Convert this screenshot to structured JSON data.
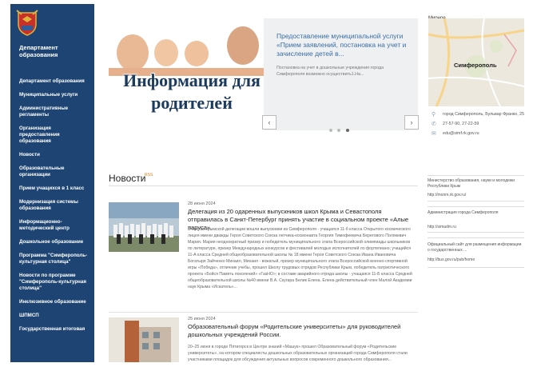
{
  "sidebar": {
    "title": "Департамент образования",
    "items": [
      {
        "label": "Департамент образования"
      },
      {
        "label": "Муниципальные услуги"
      },
      {
        "label": "Административные регламенты"
      },
      {
        "label": "Организация предоставления образования"
      },
      {
        "label": "Новости"
      },
      {
        "label": "Образовательные организации"
      },
      {
        "label": "Прием учащихся в 1 класс"
      },
      {
        "label": "Модернизация системы образования"
      },
      {
        "label": "Информационно-методический центр"
      },
      {
        "label": "Дошкольное образование"
      },
      {
        "label": "Программа \"Симферополь-культурная столица\""
      },
      {
        "label": "Новости по программе \"Симферополь-культурная столица\""
      },
      {
        "label": "Инклюзивное образование"
      },
      {
        "label": "ШПМСП"
      },
      {
        "label": "Государственная итоговая"
      }
    ]
  },
  "slider": {
    "banner_text": "Информация для родителей",
    "slide_title": "Предоставление муниципальной услуги «Прием заявлений, постановка на учет и зачисление детей в...",
    "slide_text": "Постановка на учет в дошкольные учреждения города Симферополя возможно осуществить1.На...",
    "prev": "‹",
    "next": "›"
  },
  "map": {
    "label": "Мирное",
    "city": "Симферополь"
  },
  "contacts": [
    {
      "icon": "location-icon",
      "glyph": "⚲",
      "text": "город Симферополь, Бульвар Франко, 25"
    },
    {
      "icon": "phone-icon",
      "glyph": "✆",
      "text": "27-57-90, 27-22-59"
    },
    {
      "icon": "email-icon",
      "glyph": "✉",
      "text": "edu@simf.rk.gov.ru"
    }
  ],
  "news": {
    "heading": "Новости",
    "rss": "RSS",
    "items": [
      {
        "date": "28 июня 2024",
        "title": "Делегация из 20 одаренных выпускников школ Крыма и Севастополя отправилась в Санкт-Петербург принять участие в социальном проекте «Алые паруса»",
        "text": "В состав крымской делегации вошли выпускники из Симферополя - учащаяся 11-б класса Открытого космического лицея имени дважды Героя Советского Союза летчика-космонавта Георгия Тимофеевича Берегового Полякевич Мария. Мария неоднократный призер и победитель муниципального этапа Всероссийской олимпиады школьников по литературе, призер Международных конкурсов и фестивалей молодых исполнителей по фортепиано; учащийся 11-А класса Средней общеобразовательной школы № 18 имени Героя Советского Союза Ивана Ивановича Богатыря Зайченко Михаил, Михаил - вожатый, призер муниципального этапа Всероссийской военно-спортивной игры «Победа», отличник учебы, прошел Школу трудовых отрядов Республики Крым, победитель патриотического проекта «Бойся Память поколений» «ГазНО»; в составе аварийного отряда школы - учащаяся 11-Б класса Средней общеобразовательной школы №40 имени В.А. Скугара Белик Елена. Елена действительный член Малой Академии наук Крыма «Искатель»..."
      },
      {
        "date": "25 июня 2024",
        "title": "Образовательный форум «Родительские университеты» для руководителей дошкольных учреждений России.",
        "text": "20–25 июня в городе Пятигорск в Центре знаний «Машук» прошел Образовательный форум «Родительские университеты», на котором специалисты дошкольных образовательных организаций города Симферополя стали участниками площадок для обсуждения актуальных вопросов современного дошкольного образования..."
      }
    ]
  },
  "links": [
    {
      "title": "Министерство образования, науки и молодежи Республики Крым",
      "url": "http://monm.rk.gov.ru/"
    },
    {
      "title": "Администрация города Симферополя",
      "url": "http://simadm.ru"
    },
    {
      "title": "Официальный сайт для размещения информации о государственных ...",
      "url": "http://bus.gov.ru/pub/home"
    }
  ]
}
